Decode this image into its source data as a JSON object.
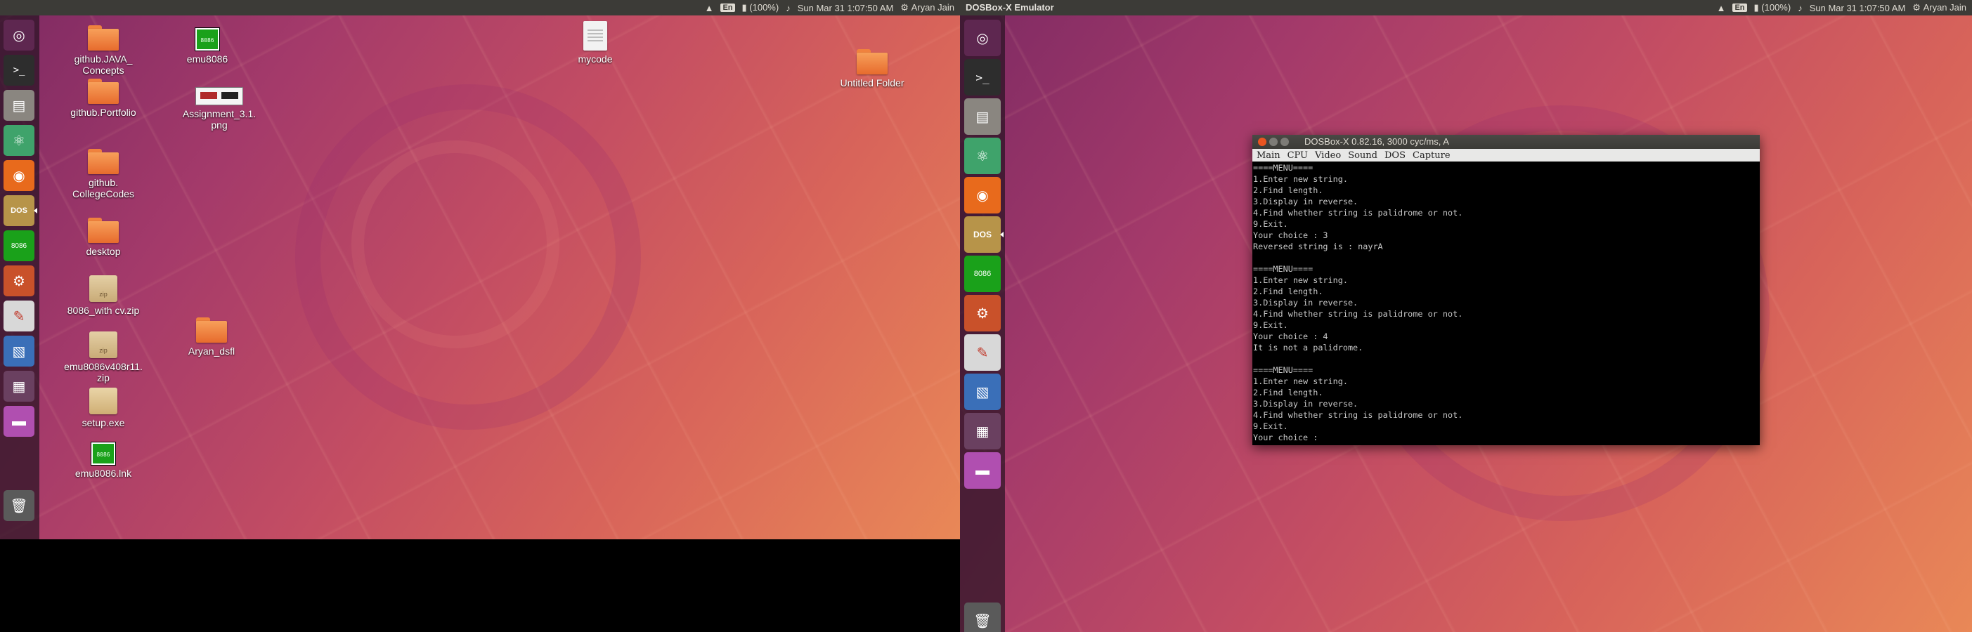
{
  "left_screen": {
    "topbar": {
      "keyboard": "En",
      "battery": "(100%)",
      "datetime": "Sun Mar 31  1:07:50 AM",
      "user": "Aryan Jain"
    },
    "desktop_icons": [
      {
        "label": "github.JAVA_\nConcepts",
        "kind": "folder"
      },
      {
        "label": "emu8086",
        "kind": "chip"
      },
      {
        "label": "mycode",
        "kind": "doc"
      },
      {
        "label": "Untitled Folder",
        "kind": "folder"
      },
      {
        "label": "github.Portfolio",
        "kind": "folder"
      },
      {
        "label": "Assignment_3.1.\npng",
        "kind": "png"
      },
      {
        "label": "github.\nCollegeCodes",
        "kind": "folder"
      },
      {
        "label": "desktop",
        "kind": "folder"
      },
      {
        "label": "8086_with cv.zip",
        "kind": "zip"
      },
      {
        "label": "Aryan_dsfl",
        "kind": "folder"
      },
      {
        "label": "emu8086v408r11.\nzip",
        "kind": "zip"
      },
      {
        "label": "setup.exe",
        "kind": "exe"
      },
      {
        "label": "emu8086.lnk",
        "kind": "chip"
      }
    ]
  },
  "right_screen": {
    "topbar": {
      "app_title": "DOSBox-X Emulator",
      "keyboard": "En",
      "battery": "(100%)",
      "datetime": "Sun Mar 31  1:07:50 AM",
      "user": "Aryan Jain"
    },
    "dosbox": {
      "title": "DOSBox-X 0.82.16, 3000 cyc/ms, A",
      "menu": [
        "Main",
        "CPU",
        "Video",
        "Sound",
        "DOS",
        "Capture"
      ],
      "lines": [
        "====MENU====",
        "1.Enter new string.",
        "2.Find length.",
        "3.Display in reverse.",
        "4.Find whether string is palidrome or not.",
        "9.Exit.",
        "Your choice : 3",
        "Reversed string is : nayrA",
        "",
        "====MENU====",
        "1.Enter new string.",
        "2.Find length.",
        "3.Display in reverse.",
        "4.Find whether string is palidrome or not.",
        "9.Exit.",
        "Your choice : 4",
        "It is not a palidrome.",
        "",
        "====MENU====",
        "1.Enter new string.",
        "2.Find length.",
        "3.Display in reverse.",
        "4.Find whether string is palidrome or not.",
        "9.Exit.",
        "Your choice : "
      ]
    }
  },
  "launcher_items": [
    {
      "name": "ubuntu-dash",
      "color": "#5e2750"
    },
    {
      "name": "terminal",
      "color": "#2d2d2d"
    },
    {
      "name": "file-manager",
      "color": "#8a8680"
    },
    {
      "name": "atom-editor",
      "color": "#3fa36b"
    },
    {
      "name": "firefox",
      "color": "#e86a1c"
    },
    {
      "name": "dosbox",
      "color": "#b79449"
    },
    {
      "name": "emu8086",
      "color": "#1aa11a"
    },
    {
      "name": "system-settings",
      "color": "#c9512a"
    },
    {
      "name": "text-editor",
      "color": "#d8d8d8"
    },
    {
      "name": "image-viewer",
      "color": "#3a6fb8"
    },
    {
      "name": "workspace-switcher",
      "color": "#6a4060"
    },
    {
      "name": "screen-window",
      "color": "#b04fb0"
    },
    {
      "name": "trash",
      "color": "#5a5a5a"
    }
  ]
}
